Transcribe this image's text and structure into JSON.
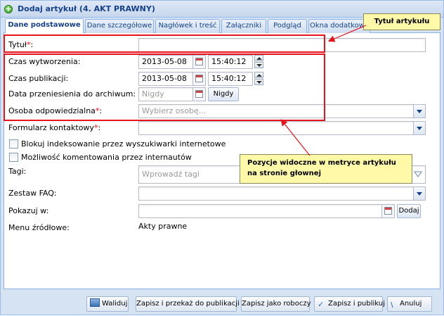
{
  "window": {
    "title": "Dodaj artykuł (4. AKT PRAWNY)"
  },
  "tabs": [
    {
      "label": "Dane podstawowe",
      "active": true
    },
    {
      "label": "Dane szczegółowe",
      "active": false
    },
    {
      "label": "Nagłówek i treść",
      "active": false
    },
    {
      "label": "Załączniki",
      "active": false
    },
    {
      "label": "Podgląd",
      "active": false
    },
    {
      "label": "Okna dodatkowe",
      "active": false
    }
  ],
  "form": {
    "title_label": "Tytuł",
    "title_value": "",
    "created_label": "Czas wytworzenia:",
    "created_date": "2013-05-08",
    "created_time": "15:40:12",
    "published_label": "Czas publikacji:",
    "published_date": "2013-05-08",
    "published_time": "15:40:12",
    "archive_label": "Data przeniesienia do archiwum:",
    "archive_placeholder": "Nigdy",
    "archive_never_button": "Nigdy",
    "responsible_label": "Osoba odpowiedzialna",
    "responsible_placeholder": "Wybierz osobę...",
    "contact_form_label": "Formularz kontaktowy",
    "block_indexing_label": "Blokuj indeksowanie przez wyszukiwarki internetowe",
    "allow_comments_label": "Możliwość komentowania przez internautów",
    "tags_label": "Tagi:",
    "tags_placeholder": "Wprowadź tagi",
    "faq_label": "Zestaw FAQ:",
    "show_in_label": "Pokazuj w:",
    "show_in_add_button": "Dodaj",
    "source_menu_label": "Menu źródłowe:",
    "source_menu_value": "Akty prawne",
    "required_marker": "*"
  },
  "annotations": {
    "title_callout": "Tytuł artykułu",
    "metrics_callout": "Pozycje widoczne w metryce artykułu na stronie głownej",
    "highlight_color": "#e8141b",
    "callout_color": "#fff9a8"
  },
  "footer": {
    "validate": "Waliduj",
    "save_publish_request": "Zapisz i przekaż do publikacji",
    "save_draft": "Zapisz jako roboczy",
    "save_publish": "Zapisz i publikuj",
    "cancel": "Anuluj"
  }
}
